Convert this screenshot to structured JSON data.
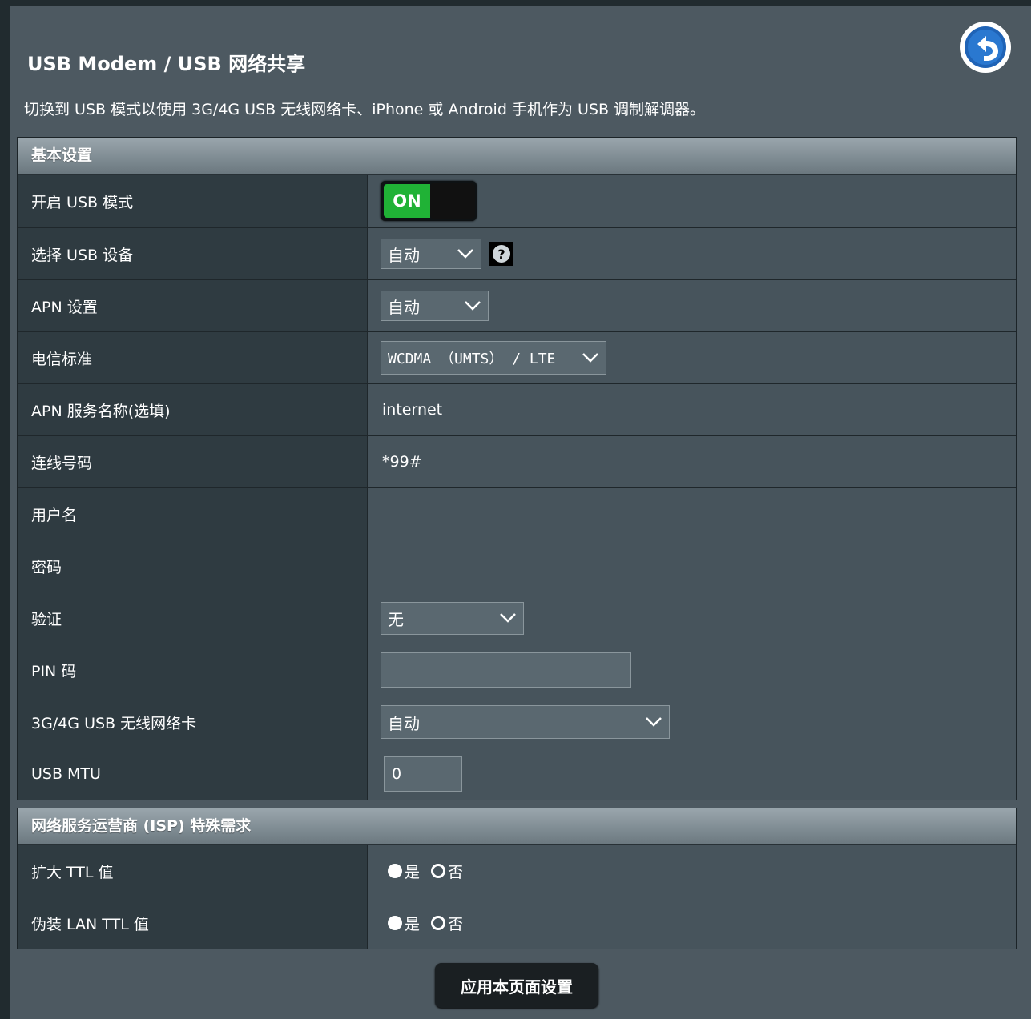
{
  "header": {
    "title": "USB Modem / USB 网络共享",
    "description": "切换到 USB 模式以使用 3G/4G USB 无线网络卡、iPhone 或 Android 手机作为 USB 调制解调器。",
    "back_icon": "back-arrow-icon"
  },
  "basic": {
    "section_title": "基本设置",
    "rows": {
      "usb_mode": {
        "label": "开启 USB 模式",
        "toggle_text": "ON",
        "state": "on"
      },
      "usb_device": {
        "label": "选择 USB 设备",
        "value": "自动",
        "help": "?"
      },
      "apn_setting": {
        "label": "APN 设置",
        "value": "自动"
      },
      "telecom_standard": {
        "label": "电信标准",
        "value": "WCDMA （UMTS） / LTE"
      },
      "apn_service": {
        "label": "APN 服务名称(选填)",
        "value": "internet"
      },
      "dial_number": {
        "label": "连线号码",
        "value": "*99#"
      },
      "username": {
        "label": "用户名",
        "value": ""
      },
      "password": {
        "label": "密码",
        "value": ""
      },
      "auth": {
        "label": "验证",
        "value": "无"
      },
      "pin": {
        "label": "PIN 码",
        "value": ""
      },
      "adapter": {
        "label": "3G/4G USB 无线网络卡",
        "value": "自动"
      },
      "mtu": {
        "label": "USB MTU",
        "value": "0"
      }
    }
  },
  "isp": {
    "section_title": "网络服务运营商 (ISP) 特殊需求",
    "rows": {
      "extend_ttl": {
        "label": "扩大 TTL 值",
        "yes": "是",
        "no": "否",
        "selected": "是"
      },
      "spoof_ttl": {
        "label": "伪装 LAN TTL 值",
        "yes": "是",
        "no": "否",
        "selected": "是"
      }
    }
  },
  "footer": {
    "apply_label": "应用本页面设置"
  },
  "colors": {
    "toggle_on": "#20b236",
    "panel": "#4d5961",
    "label_bg": "#2f3b41",
    "value_bg": "#47545c"
  }
}
